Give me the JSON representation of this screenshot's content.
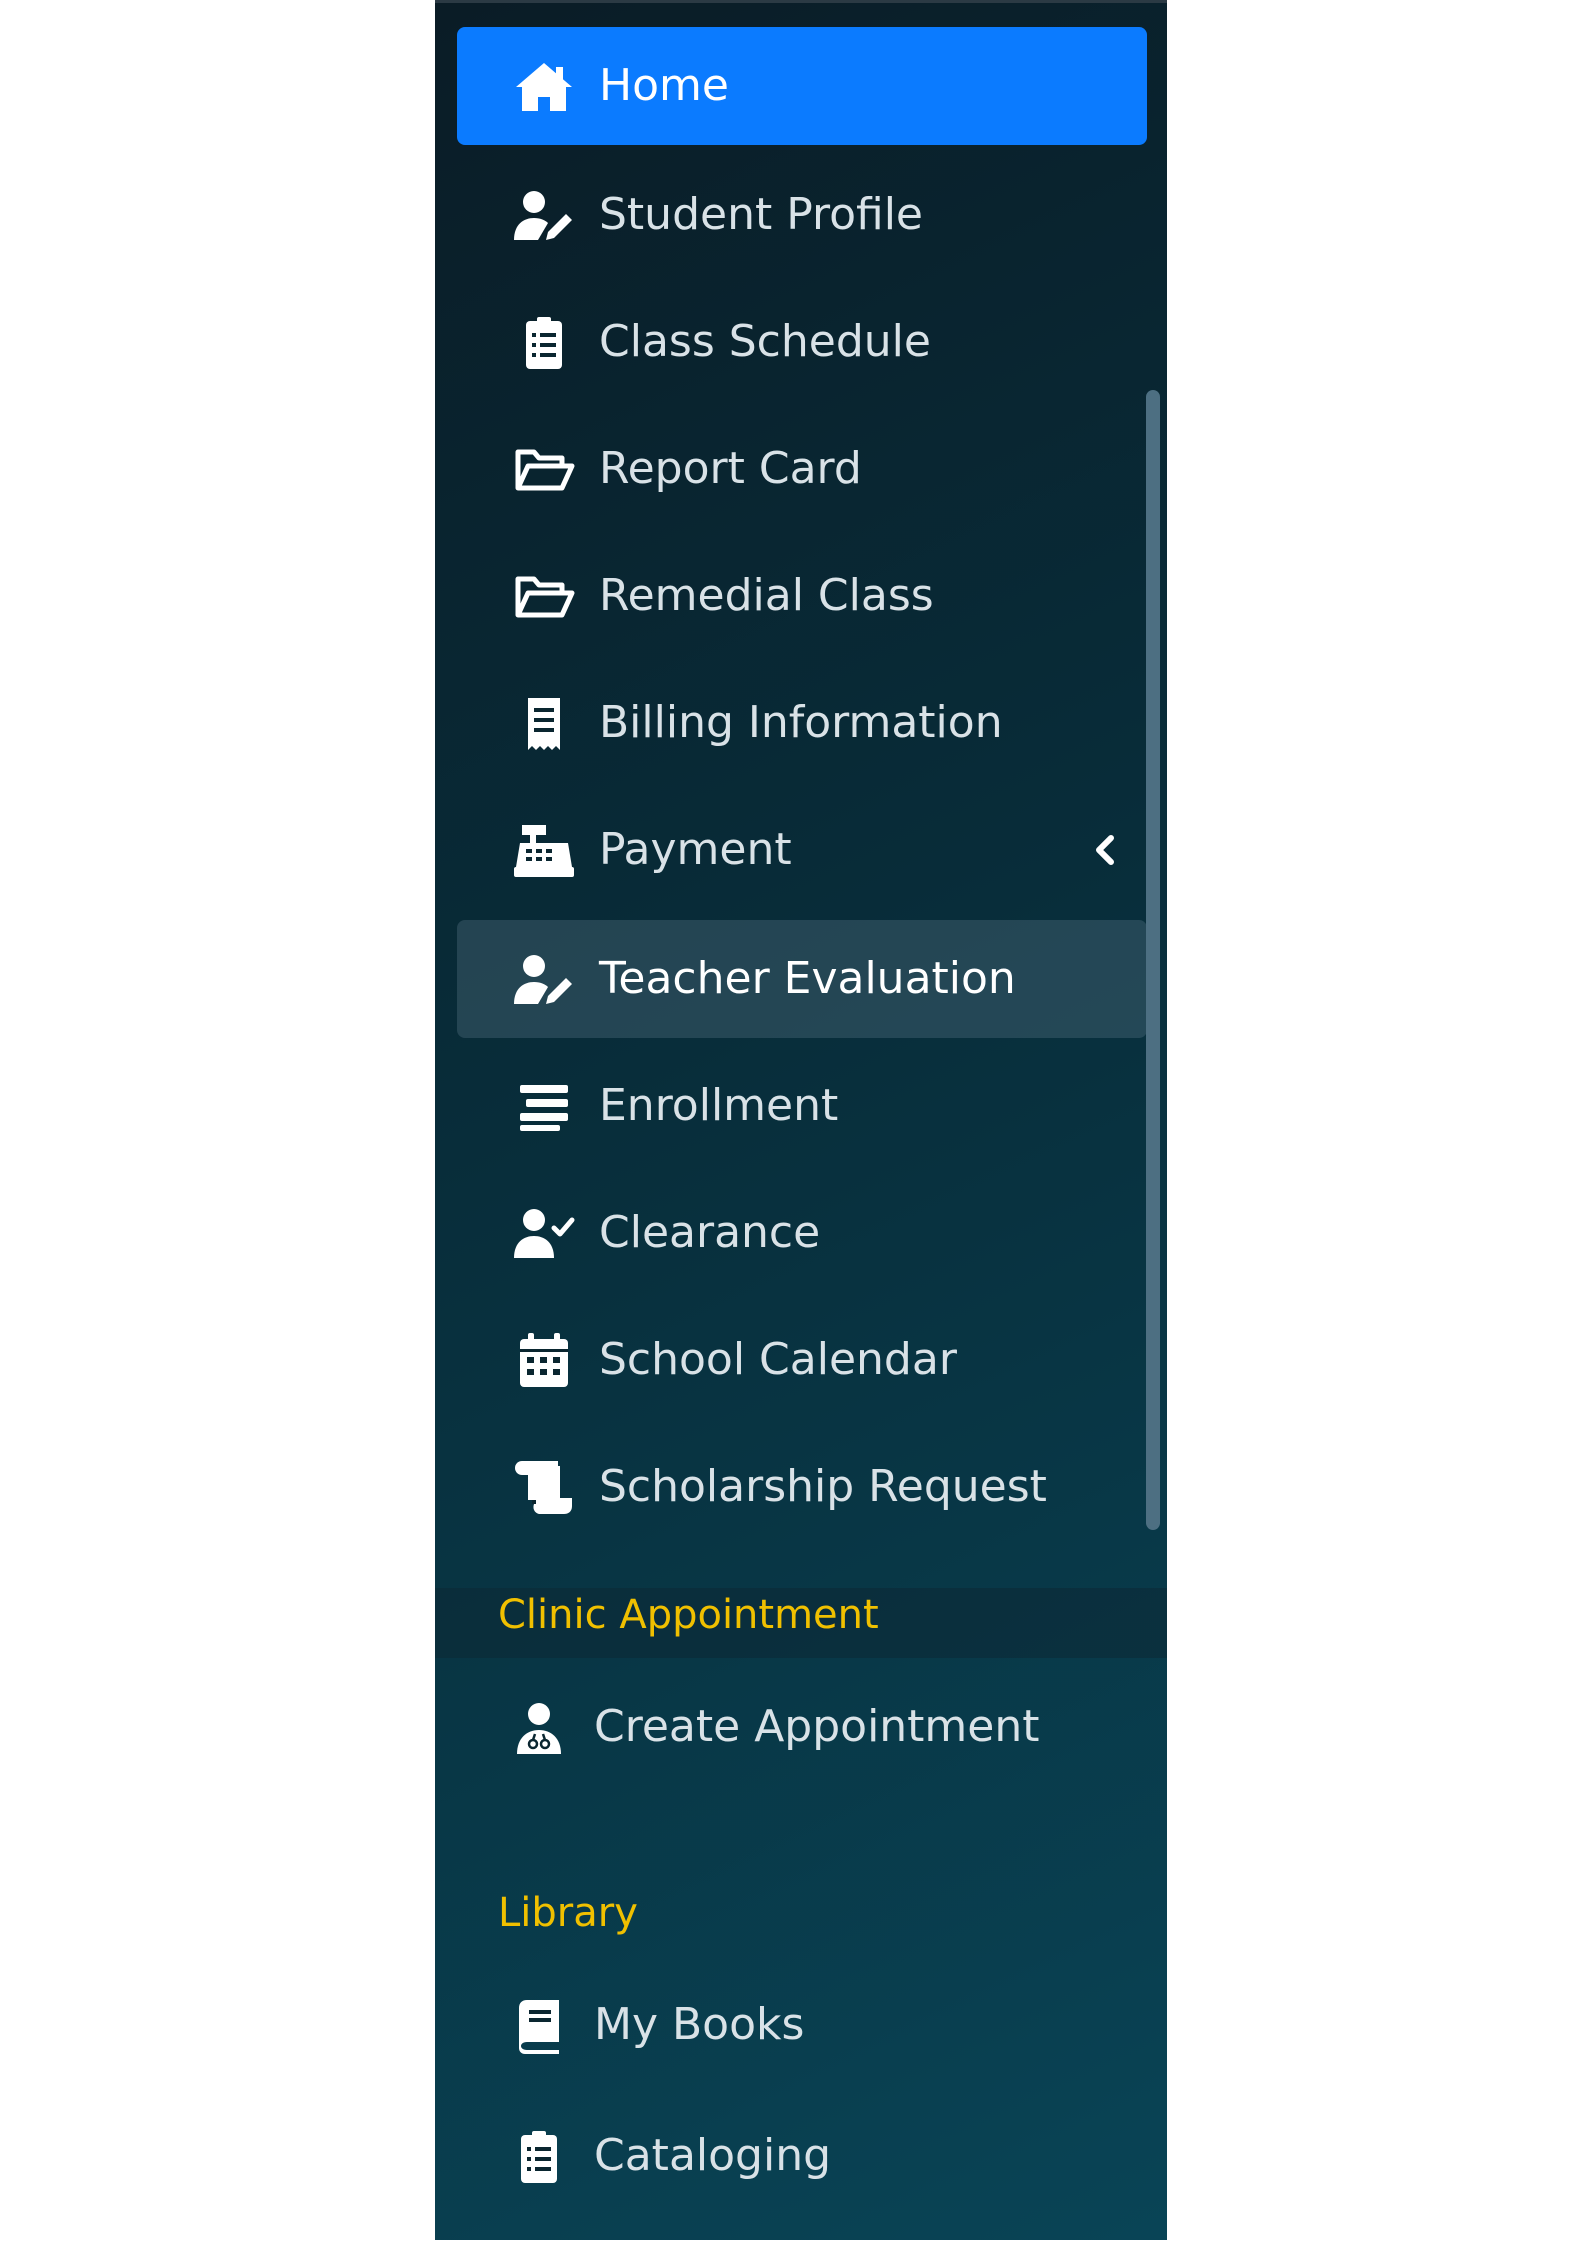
{
  "sidebar": {
    "items": [
      {
        "label": "Home",
        "icon": "home-icon",
        "state": "active"
      },
      {
        "label": "Student Profile",
        "icon": "user-edit-icon"
      },
      {
        "label": "Class Schedule",
        "icon": "clipboard-list-icon"
      },
      {
        "label": "Report Card",
        "icon": "folder-open-icon"
      },
      {
        "label": "Remedial Class",
        "icon": "folder-open-icon"
      },
      {
        "label": "Billing Information",
        "icon": "receipt-icon"
      },
      {
        "label": "Payment",
        "icon": "cash-register-icon",
        "has_submenu": true
      },
      {
        "label": "Teacher Evaluation",
        "icon": "user-edit-icon",
        "state": "hovered"
      },
      {
        "label": "Enrollment",
        "icon": "align-center-icon"
      },
      {
        "label": "Clearance",
        "icon": "user-check-icon"
      },
      {
        "label": "School Calendar",
        "icon": "calendar-icon"
      },
      {
        "label": "Scholarship Request",
        "icon": "scroll-icon"
      }
    ],
    "sections": [
      {
        "title": "Clinic Appointment",
        "items": [
          {
            "label": "Create Appointment",
            "icon": "user-doctor-icon"
          }
        ]
      },
      {
        "title": "Library",
        "items": [
          {
            "label": "My Books",
            "icon": "book-icon"
          },
          {
            "label": "Cataloging",
            "icon": "clipboard-list-icon"
          }
        ]
      }
    ]
  },
  "colors": {
    "active_bg": "#0b7bff",
    "section_header": "#f0c000",
    "text": "#d9e2e7"
  }
}
